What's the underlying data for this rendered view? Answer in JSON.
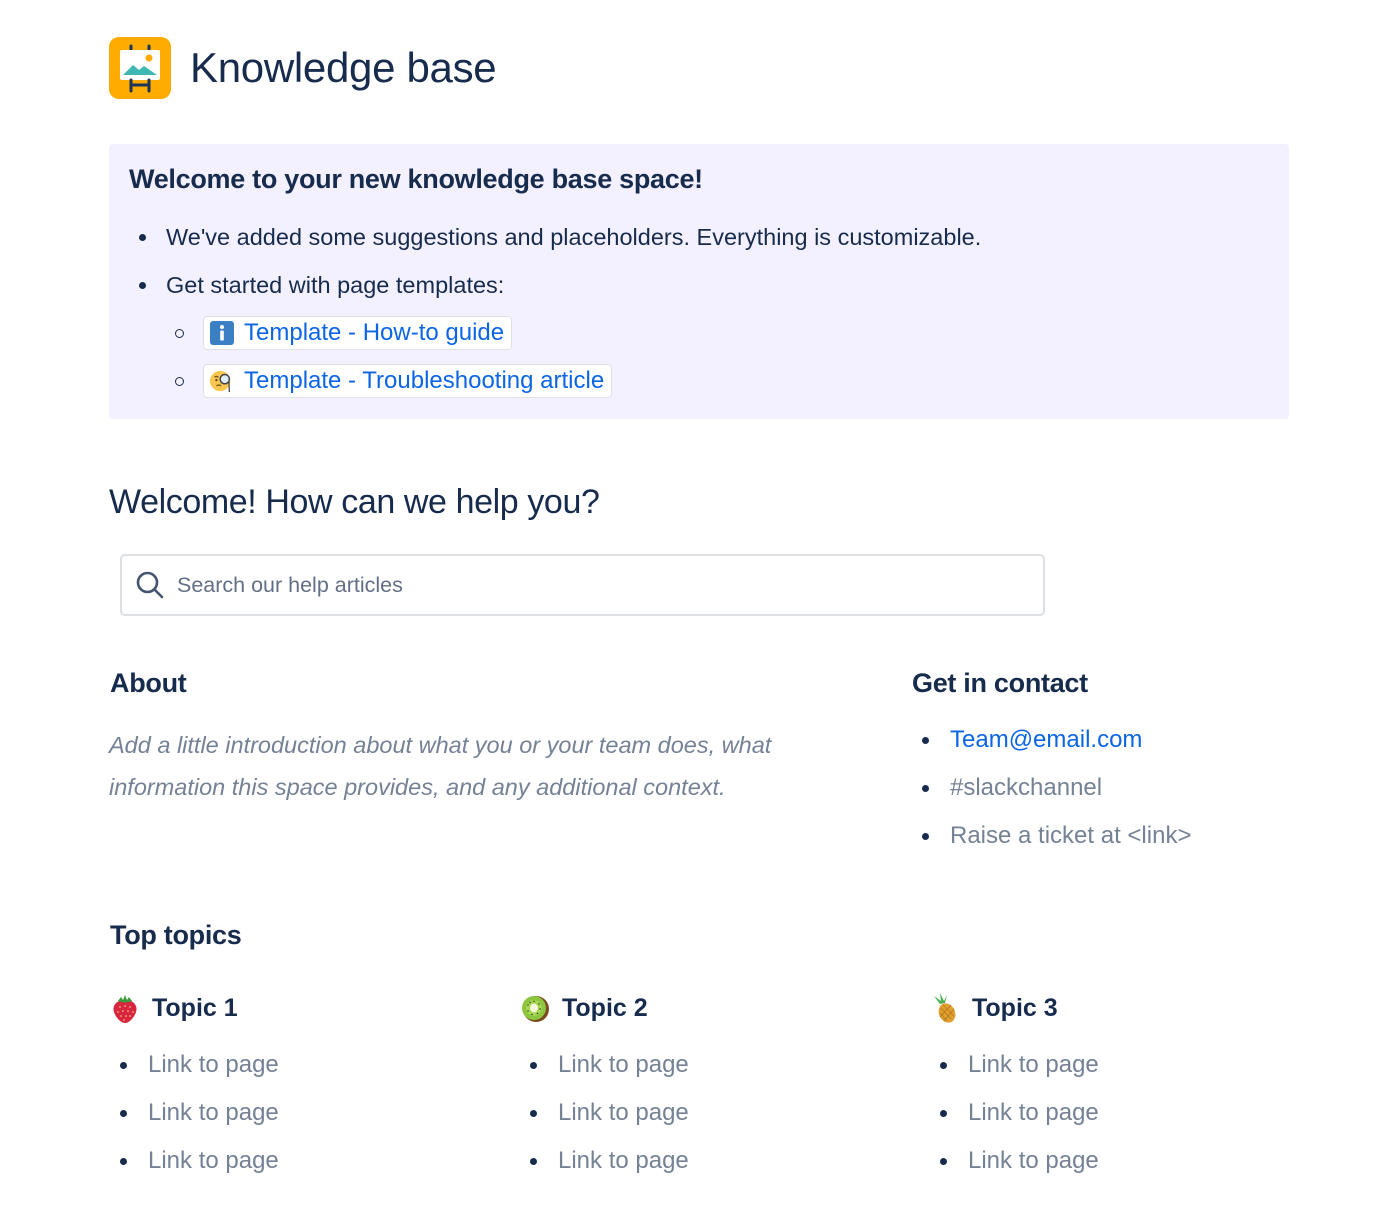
{
  "header": {
    "title": "Knowledge base",
    "logo_icon": "easel-picture-icon",
    "logo_color": "#ffab00"
  },
  "panel": {
    "background": "#f3f0ff",
    "title": "Welcome to your new knowledge base space!",
    "bullets": [
      "We've added some suggestions and placeholders. Everything is customizable.",
      "Get started with page templates:"
    ],
    "templates": [
      {
        "icon": "information-icon",
        "label": "Template - How-to guide"
      },
      {
        "icon": "face-with-monocle-icon",
        "label": "Template - Troubleshooting article"
      }
    ]
  },
  "welcome": {
    "heading": "Welcome! How can we help you?",
    "search_placeholder": "Search our help articles",
    "search_value": ""
  },
  "about": {
    "heading": "About",
    "text": "Add a little introduction about what you or your team does, what information this space provides, and any additional context."
  },
  "contact": {
    "heading": "Get in contact",
    "items": [
      {
        "text": "Team@email.com",
        "type": "link"
      },
      {
        "text": "#slackchannel",
        "type": "text"
      },
      {
        "text": "Raise a ticket at <link>",
        "type": "text"
      }
    ]
  },
  "top_topics": {
    "heading": "Top topics",
    "topics": [
      {
        "emoji": "strawberry-icon",
        "title": "Topic 1",
        "links": [
          "Link to page",
          "Link to page",
          "Link to page"
        ]
      },
      {
        "emoji": "kiwi-icon",
        "title": "Topic 2",
        "links": [
          "Link to page",
          "Link to page",
          "Link to page"
        ]
      },
      {
        "emoji": "pineapple-icon",
        "title": "Topic 3",
        "links": [
          "Link to page",
          "Link to page",
          "Link to page"
        ]
      }
    ]
  },
  "colors": {
    "text": "#172b4d",
    "link": "#0c66e4",
    "muted": "#758195"
  }
}
